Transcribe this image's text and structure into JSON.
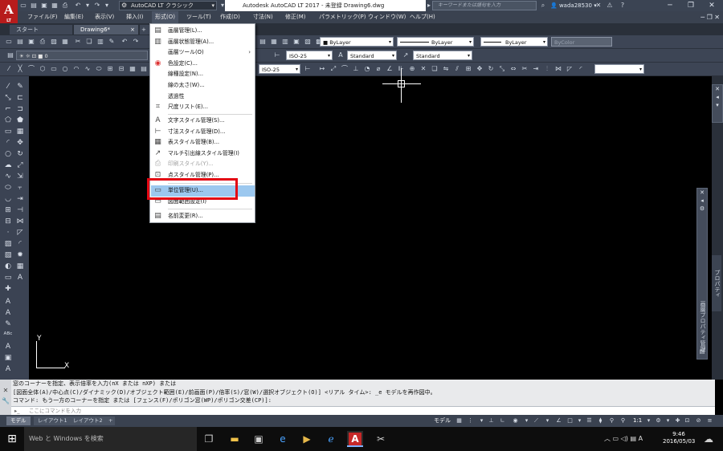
{
  "app": {
    "logo_letter": "A",
    "logo_sub": "LT",
    "workspace": "AutoCAD LT クラシック",
    "window_title": "Autodesk AutoCAD LT 2017 - 未登録    Drawing6.dwg",
    "search_placeholder": "キーワードまたは語句を入力",
    "user": "wada28530"
  },
  "menubar": [
    "ファイル(F)",
    "編集(E)",
    "表示(V)",
    "挿入(I)",
    "形式(O)",
    "ツール(T)",
    "作成(D)",
    "寸法(N)",
    "修正(M)",
    "パラメトリック(P)",
    "ウィンドウ(W)",
    "ヘルプ(H)"
  ],
  "tabs": [
    "スタート",
    "Drawing6*"
  ],
  "toolbar": {
    "layer_value": "0",
    "color_value": "ByLayer",
    "linetype_value": "ByLayer",
    "lineweight_value": "ByLayer",
    "plotstyle_value": "ByColor",
    "dimstyle_value": "ISO-25",
    "textstyle_value": "Standard",
    "tablestyle_value": "Standard",
    "dimstyle2_value": "ISO-25"
  },
  "format_menu": [
    {
      "label": "画層管理(L)...",
      "icon": "layer-icon"
    },
    {
      "label": "画層状態管理(A)...",
      "icon": "layer-state-icon"
    },
    {
      "label": "画層ツール(O)",
      "icon": "",
      "submenu": true
    },
    {
      "label": "色設定(C)...",
      "icon": "color-icon"
    },
    {
      "label": "線種設定(N)...",
      "icon": "linetype-icon"
    },
    {
      "label": "線の太さ(W)...",
      "icon": "lineweight-icon"
    },
    {
      "label": "透過性",
      "icon": ""
    },
    {
      "label": "尺度リスト(E)...",
      "icon": "scale-list-icon"
    },
    {
      "label": "文字スタイル管理(S)...",
      "icon": "text-style-icon"
    },
    {
      "label": "寸法スタイル管理(D)...",
      "icon": "dim-style-icon"
    },
    {
      "label": "表スタイル管理(B)...",
      "icon": "table-style-icon"
    },
    {
      "label": "マルチ引出線スタイル管理(I)",
      "icon": "mleader-style-icon"
    },
    {
      "label": "印刷スタイル(Y)...",
      "icon": "plot-style-icon",
      "disabled": true
    },
    {
      "label": "点スタイル管理(P)...",
      "icon": "point-style-icon"
    },
    {
      "label": "単位管理(U)...",
      "icon": "units-icon",
      "highlight": true
    },
    {
      "label": "図面範囲設定(I)",
      "icon": "limits-icon"
    },
    {
      "label": "名前変更(R)...",
      "icon": "rename-icon"
    }
  ],
  "ucs": {
    "x": "X",
    "y": "Y"
  },
  "command": {
    "history": [
      "窓のコーナーを指定、表示倍率を入力(nX または nXP) または",
      "[図面全体(A)/中心点(C)/ダイナミック(D)/オブジェクト範囲(E)/前画面(P)/倍率(S)/窓(W)/選択オブジェクト(O)] <リアル タイム>: _e モデルを再作図中。",
      "コマンド: もう一方のコーナーを指定 または [フェンス(F)/ポリゴン窓(WP)/ポリゴン交差(CP)]:"
    ],
    "placeholder": "ここにコマンドを入力"
  },
  "layout_tabs": [
    "モデル",
    "レイアウト1",
    "レイアウト2"
  ],
  "status": {
    "model": "モデル",
    "scale": "1:1"
  },
  "side_panel_label": "プロパティ",
  "side_panel_label2": "画層プロパティ管理",
  "taskbar": {
    "search": "Web と Windows を検索",
    "time": "9:46",
    "date": "2016/05/03",
    "ime": "A"
  },
  "colors": {
    "highlight_border": "#e30613",
    "menu_highlight": "#9cc8ef",
    "titlebar": "#3b4453"
  }
}
